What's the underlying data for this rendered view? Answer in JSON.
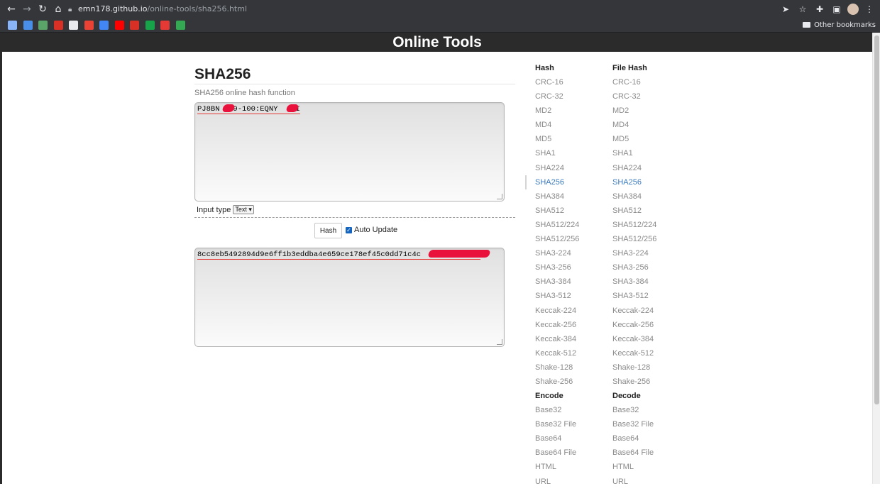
{
  "browser": {
    "url_host": "emn178.github.io",
    "url_path": "/online-tools/sha256.html",
    "other_bookmarks": "Other bookmarks",
    "bookmark_colors": [
      "#8ab4f8",
      "#4a8fe7",
      "#5aa469",
      "#d93025",
      "#e8eaed",
      "#ea4335",
      "#4285f4",
      "#ff0000",
      "#d93025",
      "#16a34a",
      "#e53935",
      "#34a853"
    ]
  },
  "header": {
    "title": "Online Tools"
  },
  "main": {
    "title": "SHA256",
    "subtitle": "SHA256 online hash function",
    "input_text": "PJ8BN  U9-100:EQNY   PI",
    "input_type_label": "Input type",
    "input_type_value": "Text",
    "hash_button": "Hash",
    "auto_update_label": "Auto Update",
    "auto_update_checked": true,
    "output_text": "8cc8eb5492894d9e6ff1b3eddba4e659ce178ef45c0dd71c4c"
  },
  "sidebar": {
    "hash_heading": "Hash",
    "file_hash_heading": "File Hash",
    "hash_items": [
      "CRC-16",
      "CRC-32",
      "MD2",
      "MD4",
      "MD5",
      "SHA1",
      "SHA224",
      "SHA256",
      "SHA384",
      "SHA512",
      "SHA512/224",
      "SHA512/256",
      "SHA3-224",
      "SHA3-256",
      "SHA3-384",
      "SHA3-512",
      "Keccak-224",
      "Keccak-256",
      "Keccak-384",
      "Keccak-512",
      "Shake-128",
      "Shake-256"
    ],
    "file_hash_items": [
      "CRC-16",
      "CRC-32",
      "MD2",
      "MD4",
      "MD5",
      "SHA1",
      "SHA224",
      "SHA256",
      "SHA384",
      "SHA512",
      "SHA512/224",
      "SHA512/256",
      "SHA3-224",
      "SHA3-256",
      "SHA3-384",
      "SHA3-512",
      "Keccak-224",
      "Keccak-256",
      "Keccak-384",
      "Keccak-512",
      "Shake-128",
      "Shake-256"
    ],
    "active_item": "SHA256",
    "encode_heading": "Encode",
    "decode_heading": "Decode",
    "encode_items": [
      "Base32",
      "Base32 File",
      "Base64",
      "Base64 File",
      "HTML",
      "URL"
    ],
    "decode_items": [
      "Base32",
      "Base32 File",
      "Base64",
      "Base64 File",
      "HTML",
      "URL"
    ]
  }
}
